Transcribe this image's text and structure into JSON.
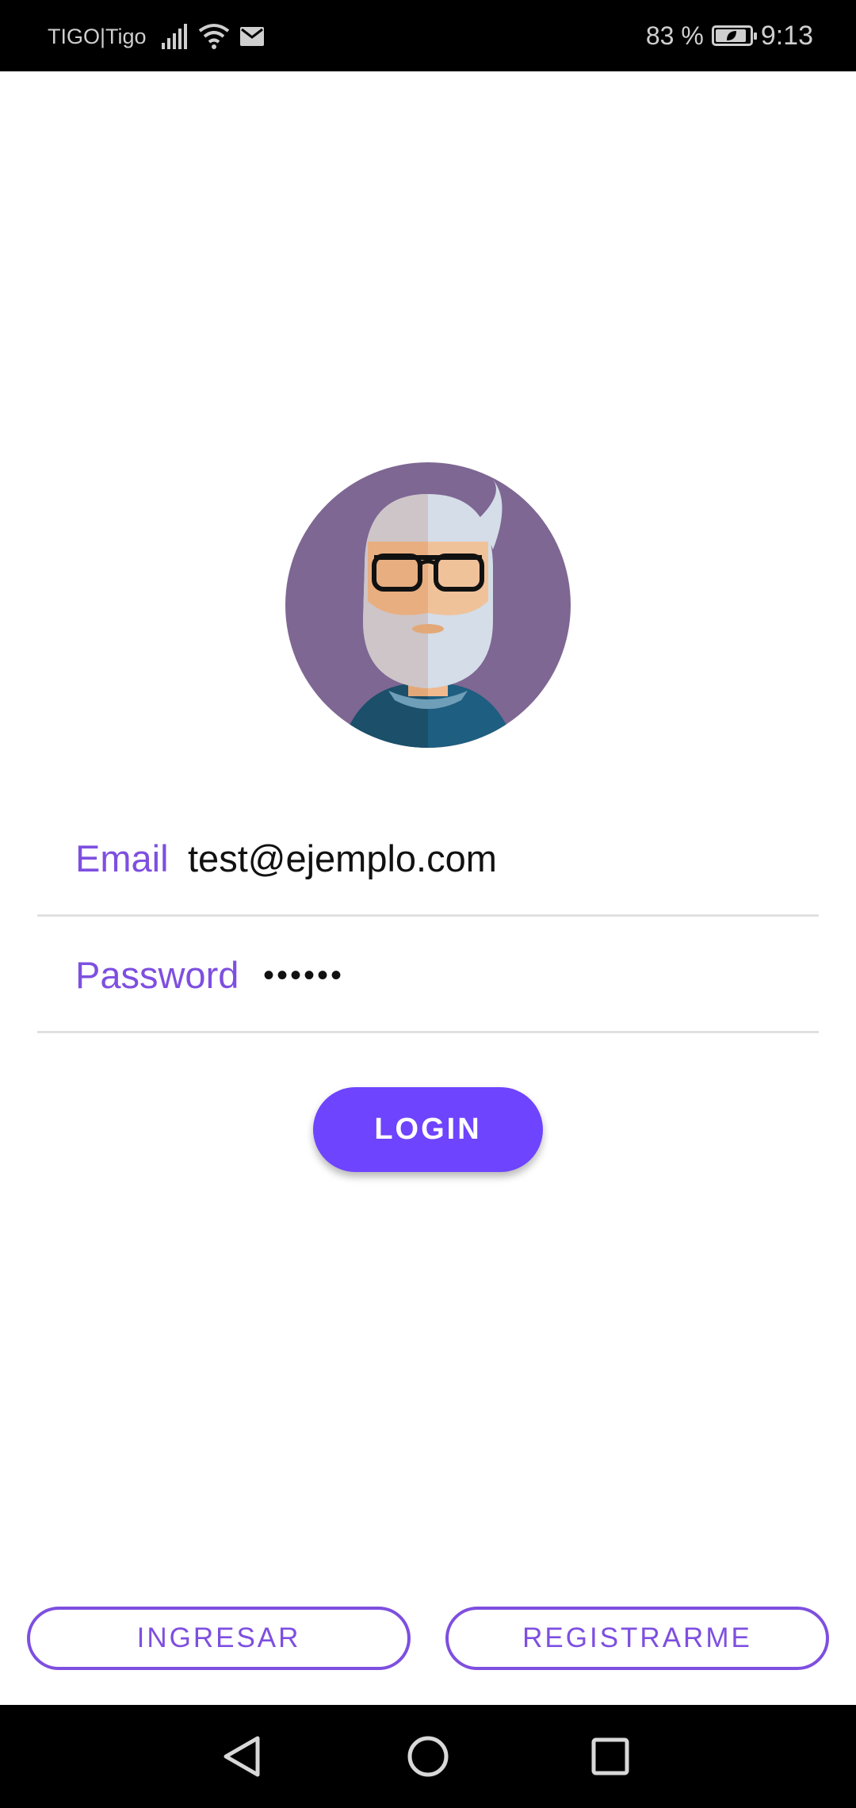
{
  "status_bar": {
    "carrier": "TIGO|Tigo",
    "battery_percent": "83 %",
    "time": "9:13",
    "icons": [
      "signal-icon",
      "wifi-icon",
      "mail-icon",
      "battery-icon"
    ]
  },
  "avatar": {
    "icon": "avatar-bearded-man-glasses",
    "background": "#7e6793"
  },
  "form": {
    "email_label": "Email",
    "email_value": "test@ejemplo.com",
    "password_label": "Password",
    "password_value": "••••••"
  },
  "login_label": "LOGIN",
  "bottom_buttons": {
    "ingresar": "INGRESAR",
    "registrarme": "REGISTRARME"
  },
  "colors": {
    "accent": "#6e44ff",
    "label_purple": "#7e4fe0"
  },
  "nav_bar": {
    "icons": [
      "back-icon",
      "home-icon",
      "recents-icon"
    ]
  }
}
